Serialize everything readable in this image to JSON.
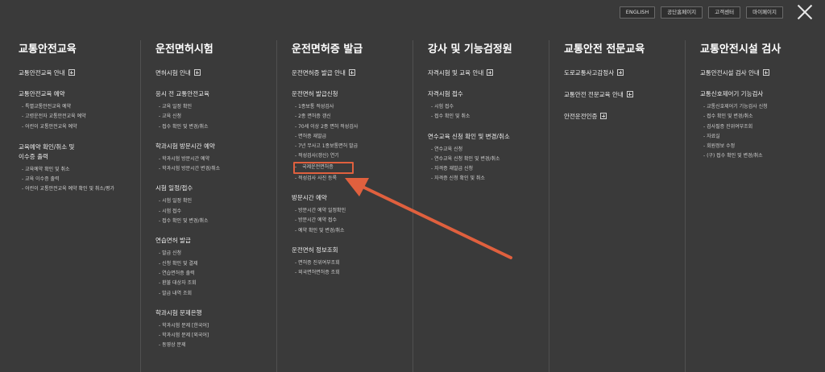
{
  "header": {
    "buttons": [
      "ENGLISH",
      "공단홈페이지",
      "고객센터",
      "마이페이지"
    ]
  },
  "colors": {
    "background": "#3a3a3a",
    "highlight": "#e0603e"
  },
  "columns": [
    {
      "title": "교통안전교육",
      "sections": [
        {
          "title": "교통안전교육 안내",
          "plus": true,
          "items": []
        },
        {
          "title": "교통안전교육 예약",
          "plus": false,
          "items": [
            "특별교통안전교육 예약",
            "고령운전자 교통안전교육 예약",
            "어린이 교통안전교육 예약"
          ]
        },
        {
          "title": "교육예약 확인/취소 및",
          "plus": false,
          "items": []
        },
        {
          "title": "이수증 출력",
          "plus": false,
          "items": [
            "교육예약 확인 및 취소",
            "교육 이수증 출력",
            "어린이 교통안전교육 예약 확인 및 취소/평가"
          ]
        }
      ]
    },
    {
      "title": "운전면허시험",
      "sections": [
        {
          "title": "면허시험 안내",
          "plus": true,
          "items": []
        },
        {
          "title": "응시 전 교통안전교육",
          "plus": false,
          "items": [
            "교육 일정 확인",
            "교육 신청",
            "접수 확인 및 변경/취소"
          ]
        },
        {
          "title": "학과시험 방문시간 예약",
          "plus": false,
          "items": [
            "학과시험 방문시간 예약",
            "학과시험 방문시간 변경/취소"
          ]
        },
        {
          "title": "시험 일정/접수",
          "plus": false,
          "items": [
            "시험 일정 확인",
            "시험 접수",
            "접수 확인 및 변경/취소"
          ]
        },
        {
          "title": "연습면허 발급",
          "plus": false,
          "items": [
            "발급 신청",
            "신청 확인 및 결제",
            "연습면허증 출력",
            "환불 대상자 조회",
            "발급 내역 조회"
          ]
        },
        {
          "title": "학과시험 문제은행",
          "plus": false,
          "items": [
            "학과시험 문제 [한국어]",
            "학과시험 문제 [외국어]",
            "동영상 문제"
          ]
        }
      ]
    },
    {
      "title": "운전면허증 발급",
      "sections": [
        {
          "title": "운전면허증 발급 안내",
          "plus": true,
          "items": []
        },
        {
          "title": "운전면허 발급신청",
          "plus": false,
          "items": [
            "1종보통 적성검사",
            "2종 면허증 갱신",
            "70세 이상 2종 면허 적성검사",
            "면허증 재발급",
            "7년 무사고 1종보통면허 발급",
            "적성검사(갱신) 연기",
            "국제운전면허증",
            "적성검사 사진 등록"
          ]
        },
        {
          "title": "방문시간 예약",
          "plus": false,
          "items": [
            "방문시간 예약 일정확인",
            "방문시간 예약 접수",
            "예약 확인 및 변경/취소"
          ]
        },
        {
          "title": "운전면허 정보조회",
          "plus": false,
          "items": [
            "면허증 진위여부조회",
            "외국면허면허증 조회"
          ]
        }
      ]
    },
    {
      "title": "강사 및 기능검정원",
      "sections": [
        {
          "title": "자격시험 및 교육 안내",
          "plus": true,
          "items": []
        },
        {
          "title": "자격시험 접수",
          "plus": false,
          "items": [
            "시험 접수",
            "접수 확인 및 취소"
          ]
        },
        {
          "title": "연수교육 신청 확인 및 변경/취소",
          "plus": false,
          "items": [
            "연수교육 신청",
            "연수교육 신청 확인 및 변경/취소",
            "자격증 재발급 신청",
            "자격증 신청 확인 및 취소"
          ]
        }
      ]
    },
    {
      "title": "교통안전 전문교육",
      "sections": [
        {
          "title": "도로교통사고감정사",
          "plus": true,
          "items": []
        },
        {
          "title": "교통안전 전문교육 안내",
          "plus": true,
          "items": []
        },
        {
          "title": "안전운전인증",
          "plus": true,
          "items": []
        }
      ]
    },
    {
      "title": "교통안전시설 검사",
      "sections": [
        {
          "title": "교통안전시설 검사 안내",
          "plus": true,
          "items": []
        },
        {
          "title": "교통신호제어기 기능검사",
          "plus": false,
          "items": [
            "교통신호제어기 기능검사 신청",
            "접수 확인 및 변경/취소",
            "검사필증 진위여부조회",
            "자료실",
            "회원정보 수정",
            "(구) 접수 확인 및 변경/취소"
          ]
        }
      ]
    }
  ]
}
